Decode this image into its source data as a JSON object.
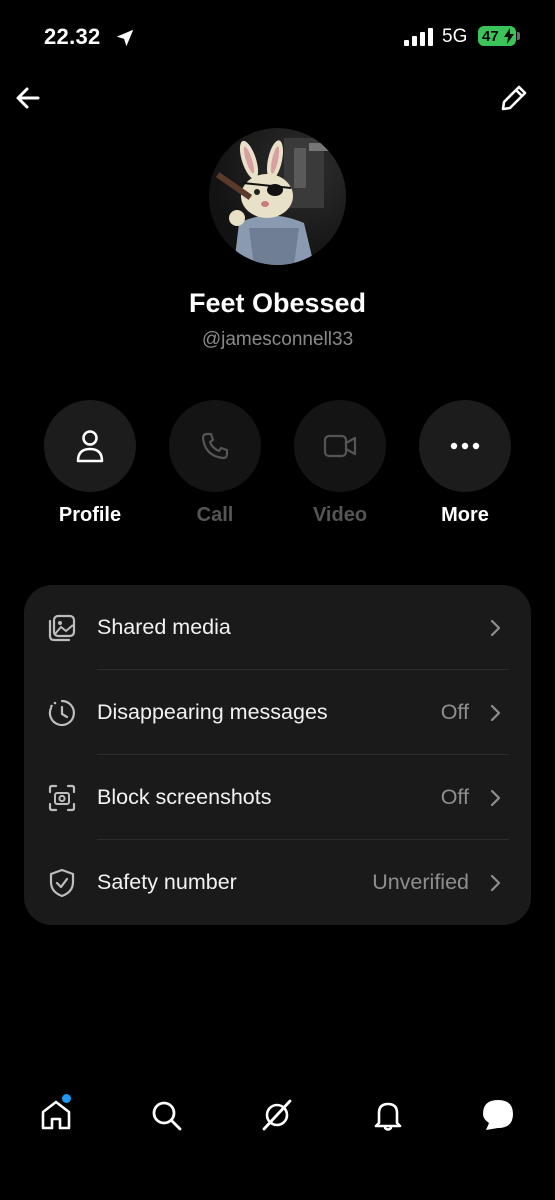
{
  "status_bar": {
    "time": "22.32",
    "network": "5G",
    "battery": "47"
  },
  "profile": {
    "name": "Feet Obessed",
    "handle": "@jamesconnell33"
  },
  "actions": [
    {
      "label": "Profile",
      "icon": "person-icon",
      "enabled": true
    },
    {
      "label": "Call",
      "icon": "phone-icon",
      "enabled": false
    },
    {
      "label": "Video",
      "icon": "video-icon",
      "enabled": false
    },
    {
      "label": "More",
      "icon": "more-dots-icon",
      "enabled": true
    }
  ],
  "settings": [
    {
      "label": "Shared media",
      "value": "",
      "icon": "media-icon"
    },
    {
      "label": "Disappearing messages",
      "value": "Off",
      "icon": "timer-icon"
    },
    {
      "label": "Block screenshots",
      "value": "Off",
      "icon": "screenshot-icon"
    },
    {
      "label": "Safety number",
      "value": "Unverified",
      "icon": "shield-icon"
    }
  ],
  "bottom_nav": [
    "home-icon",
    "search-icon",
    "grok-icon",
    "notifications-icon",
    "messages-icon"
  ],
  "colors": {
    "background": "#000000",
    "card": "#1a1a1a",
    "battery": "#3bc45a",
    "notification_dot": "#1d9bf0"
  }
}
